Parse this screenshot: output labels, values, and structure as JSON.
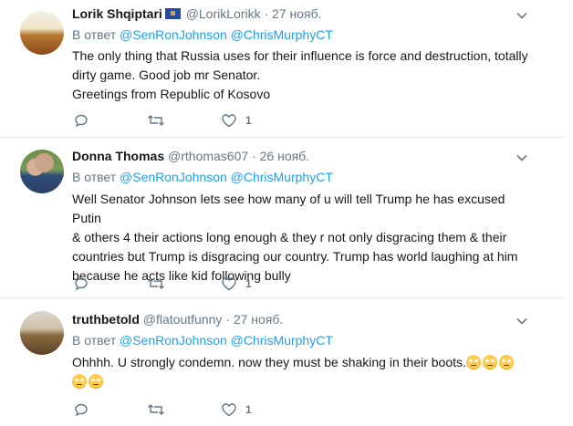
{
  "tweets": [
    {
      "name": "Lorik Shqiptari",
      "handle": "@LorikLorikk",
      "separator": "·",
      "time": "27 нояб.",
      "reply_prefix": "В ответ",
      "reply_to": "@SenRonJohnson @ChrisMurphyCT",
      "lines": [
        "The only thing that Russia uses for their influence is force and destruction, totally",
        "dirty game. Good job mr Senator.",
        "Greetings from Republic of Kosovo"
      ],
      "likes": "1",
      "flag_icon": "kosovo-flag-icon"
    },
    {
      "name": "Donna Thomas",
      "handle": "@rthomas607",
      "separator": "·",
      "time": "26 нояб.",
      "reply_prefix": "В ответ",
      "reply_to": "@SenRonJohnson @ChrisMurphyCT",
      "lines": [
        "Well Senator Johnson lets see how many of u will tell Trump he has excused Putin",
        "& others 4 their actions long enough & they r not only disgracing them & their",
        "countries but Trump is disgracing our country. Trump has world laughing at him",
        "because he acts like kid following bully"
      ],
      "likes": "1"
    },
    {
      "name": "truthbetold",
      "handle": "@flatoutfunny",
      "separator": "·",
      "time": "27 нояб.",
      "reply_prefix": "В ответ",
      "reply_to": "@SenRonJohnson @ChrisMurphyCT",
      "lines": [
        "Ohhhh. U strongly condemn. now they must be shaking in their boots."
      ],
      "emoji": "rolling-eyes-emoji",
      "likes": "1"
    }
  ],
  "colors": {
    "link": "#1da1f2",
    "muted": "#657786",
    "text": "#14171a",
    "divider": "#e6ecf0"
  }
}
